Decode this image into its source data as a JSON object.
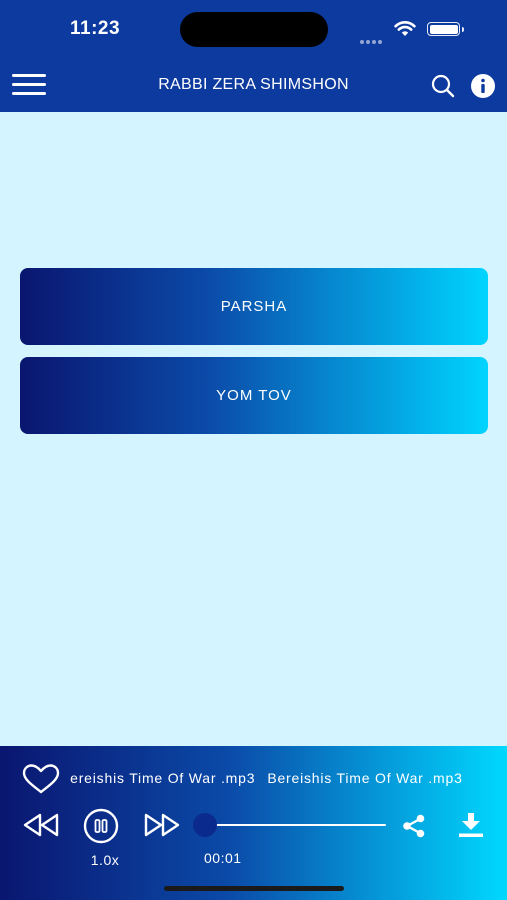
{
  "status_bar": {
    "time": "11:23"
  },
  "app_bar": {
    "title": "RABBI ZERA SHIMSHON",
    "menu_icon": "hamburger-menu-icon",
    "search_icon": "search-icon",
    "info_icon": "info-icon"
  },
  "categories": [
    {
      "label": "PARSHA"
    },
    {
      "label": "YOM TOV"
    }
  ],
  "player": {
    "now_playing": "Bereishis Time Of War .mp3",
    "speed": "1.0x",
    "elapsed": "00:01",
    "state": "playing",
    "icons": [
      "heart-icon",
      "rewind-icon",
      "pause-icon",
      "fast-forward-icon",
      "share-icon",
      "download-icon"
    ]
  },
  "colors": {
    "header": "#0d3a9e",
    "background": "#d4f4ff",
    "gradient_start": "#0a1670",
    "gradient_end": "#00d4ff",
    "seek_knob": "#0a2a8e"
  }
}
